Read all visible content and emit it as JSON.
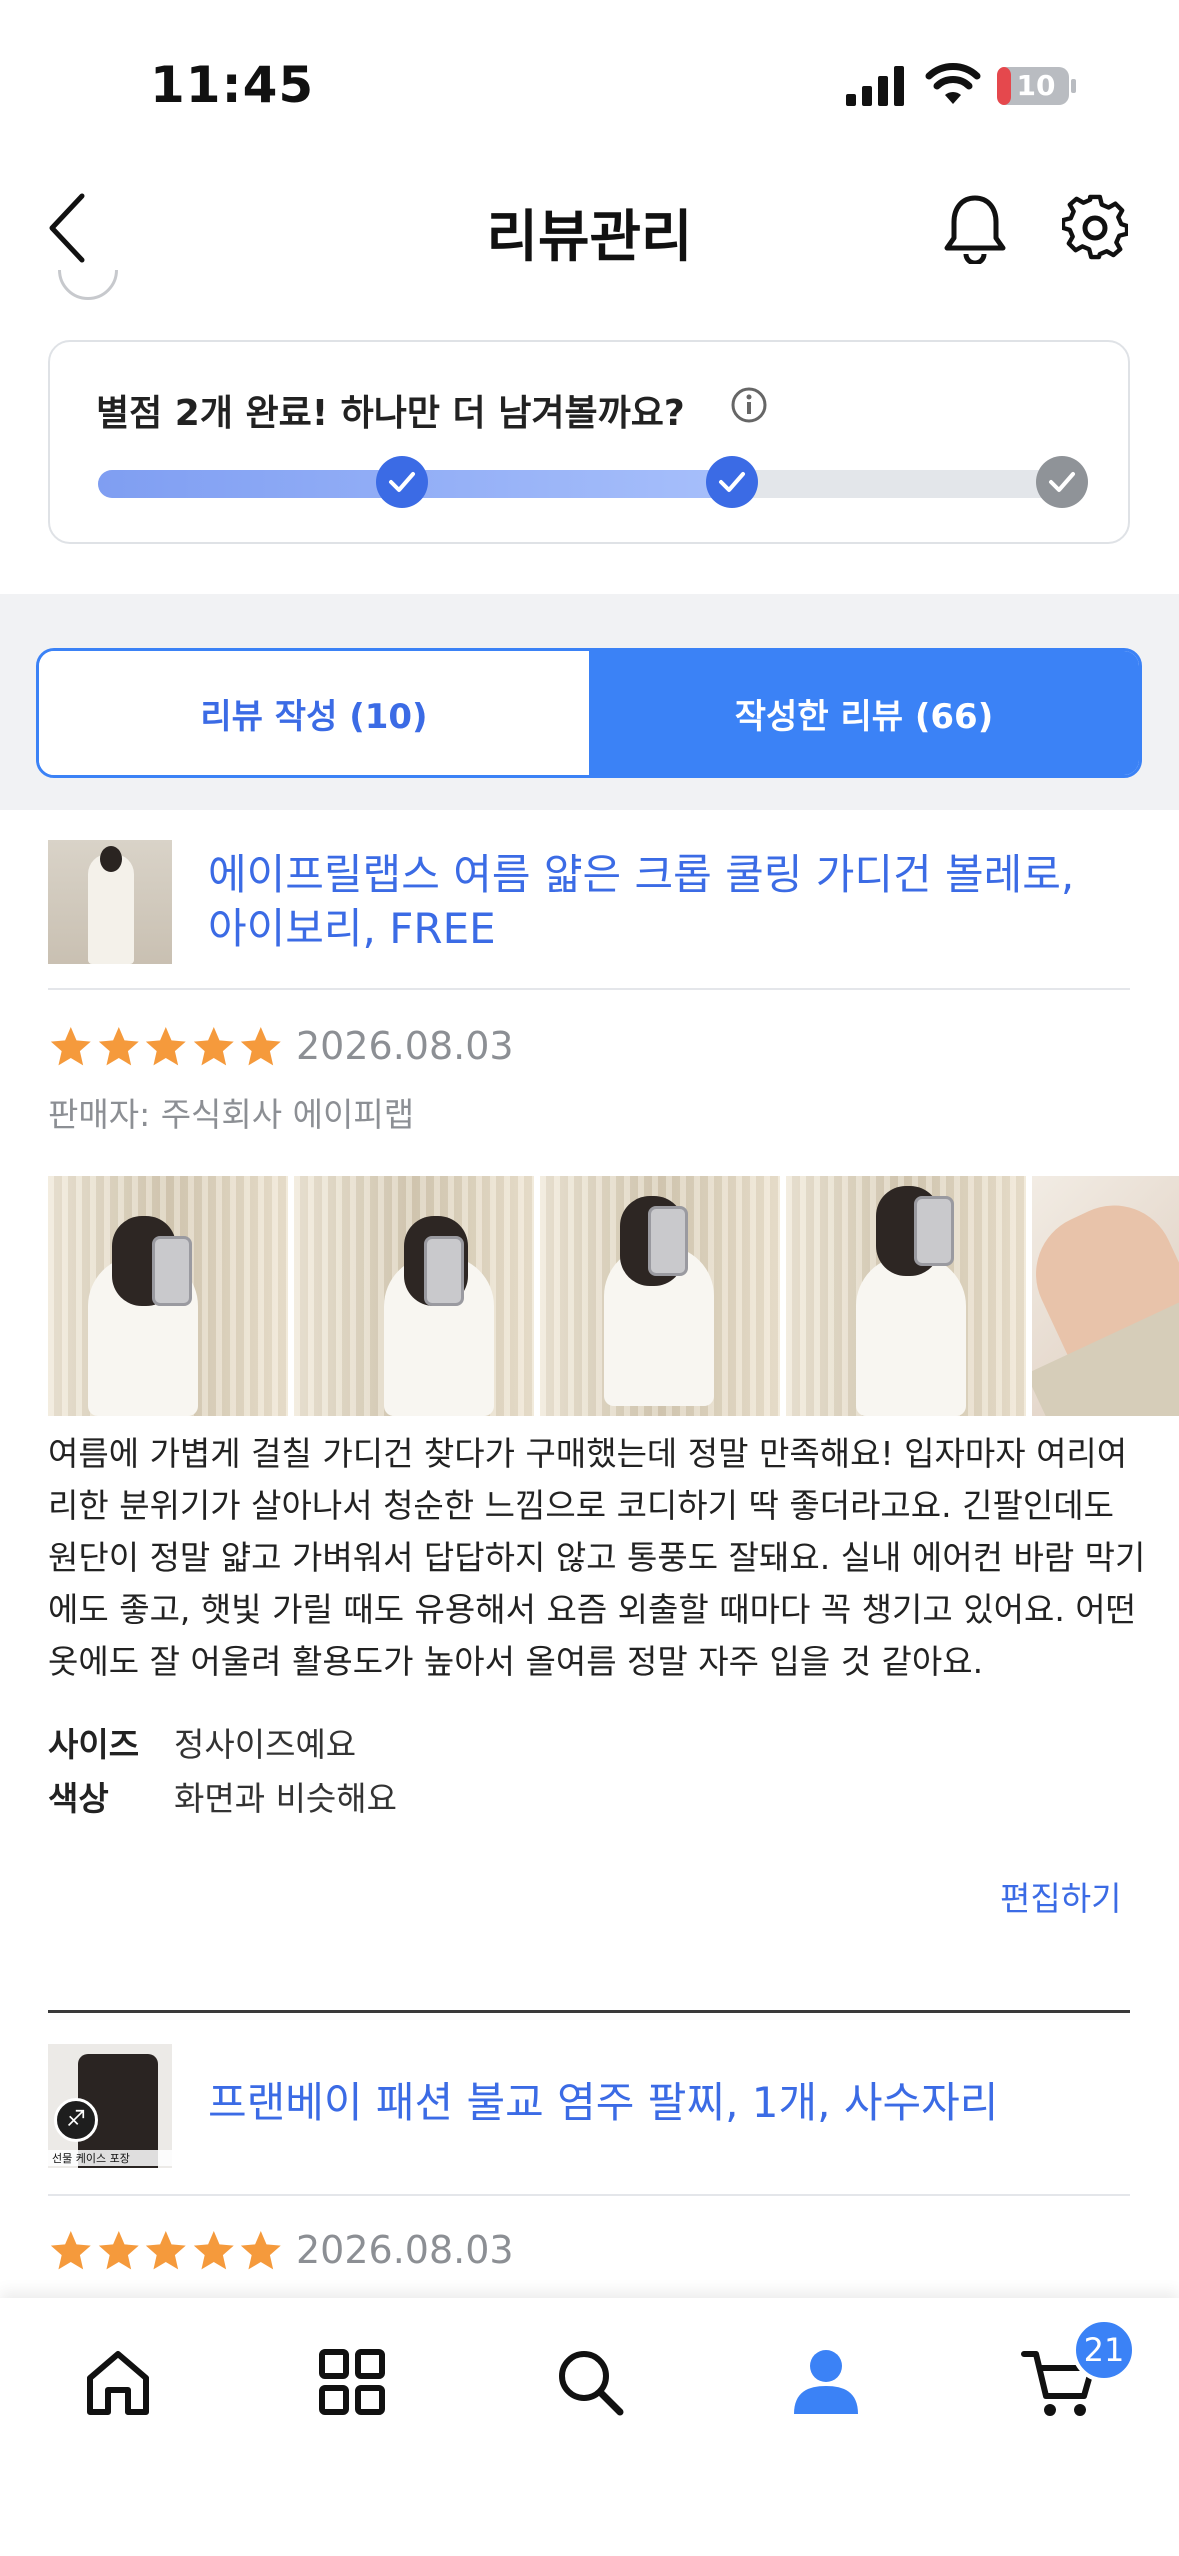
{
  "status_bar": {
    "time": "11:45",
    "battery": "10"
  },
  "header": {
    "title": "리뷰관리"
  },
  "progress": {
    "message": "별점 2개 완료! 하나만 더 남겨볼까요?",
    "fill_fraction": 0.67,
    "completed_steps": 2,
    "total_steps": 3
  },
  "tabs": [
    {
      "label": "리뷰 작성 (10)",
      "active": false
    },
    {
      "label": "작성한 리뷰 (66)",
      "active": true
    }
  ],
  "reviews": [
    {
      "product_name": "에이프릴랩스 여름 얇은 크롭 쿨링 가디건 볼레로, 아이보리, FREE",
      "rating": 5,
      "date": "2026.08.03",
      "seller": "판매자: 주식회사 에이피랩",
      "text": "여름에 가볍게 걸칠 가디건 찾다가 구매했는데 정말 만족해요!  입자마자 여리여리한 분위기가 살아나서 청순한 느낌으로 코디하기 딱 좋더라고요. 긴팔인데도 원단이 정말 얇고 가벼워서 답답하지 않고 통풍도 잘돼요. 실내 에어컨 바람 막기에도 좋고, 햇빛 가릴 때도 유용해서 요즘 외출할 때마다 꼭 챙기고 있어요. 어떤 옷에도 잘 어울려 활용도가 높아서 올여름 정말 자주 입을 것 같아요.",
      "attributes": [
        {
          "label": "사이즈",
          "value": "정사이즈예요"
        },
        {
          "label": "색상",
          "value": "화면과 비슷해요"
        }
      ],
      "edit_label": "편집하기"
    },
    {
      "product_name": "프랜베이 패션 불교 염주 팔찌, 1개, 사수자리",
      "thumb_caption": "선물 케이스 포장",
      "rating": 5,
      "date": "2026.08.03"
    }
  ],
  "bottom_nav": {
    "items": [
      "home-icon",
      "categories-icon",
      "search-icon",
      "my-page-icon",
      "cart-icon"
    ],
    "active": "my-page-icon",
    "cart_count": "21"
  },
  "colors": {
    "accent": "#3b82f6",
    "link": "#3b6be5",
    "star": "#f59a3c"
  }
}
